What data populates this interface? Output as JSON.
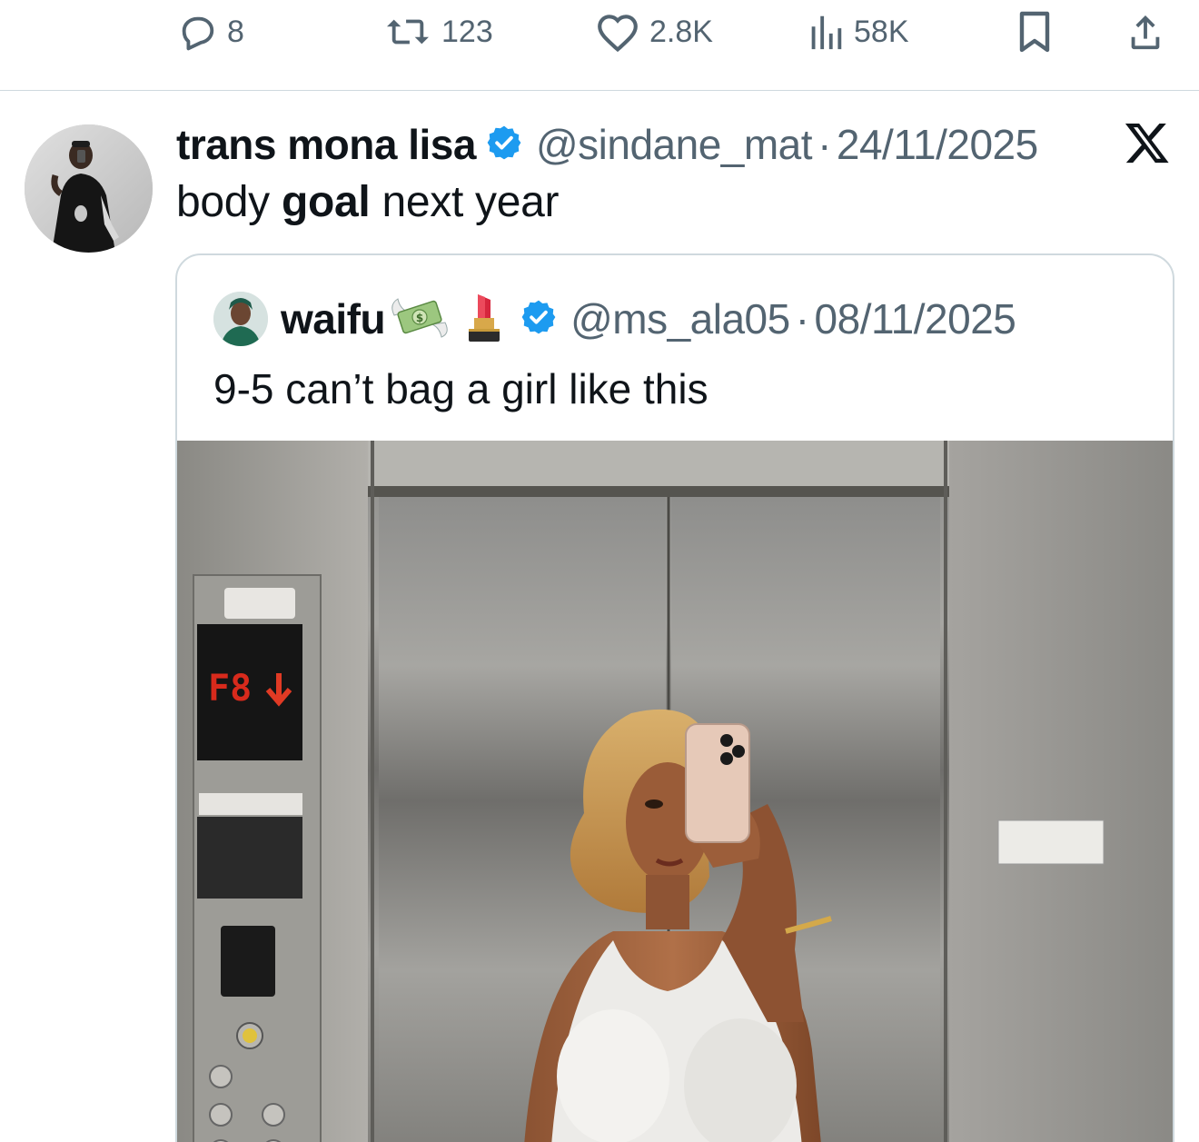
{
  "actions": {
    "replies": "8",
    "reposts": "123",
    "likes": "2.8K",
    "views": "58K",
    "icons": [
      "reply-icon",
      "repost-icon",
      "like-icon",
      "views-icon",
      "bookmark-icon",
      "share-icon"
    ]
  },
  "tweet": {
    "display_name": "trans mona lisa",
    "handle": "@sindane_mat",
    "separator": "·",
    "date": "24/11/2025",
    "text_before": "body ",
    "text_bold": "goal",
    "text_after": " next year",
    "verified": true
  },
  "quote": {
    "display_name": "waifu",
    "handle": "@ms_ala05",
    "separator": "·",
    "date": "08/11/2025",
    "text": "9-5 can’t bag a girl like this",
    "verified": true,
    "emojis": [
      "money-with-wings-icon",
      "lipstick-icon"
    ]
  },
  "colors": {
    "text": "#0f1419",
    "secondary": "#536471",
    "verified": "#1d9bf0",
    "border": "#cfd9de"
  }
}
